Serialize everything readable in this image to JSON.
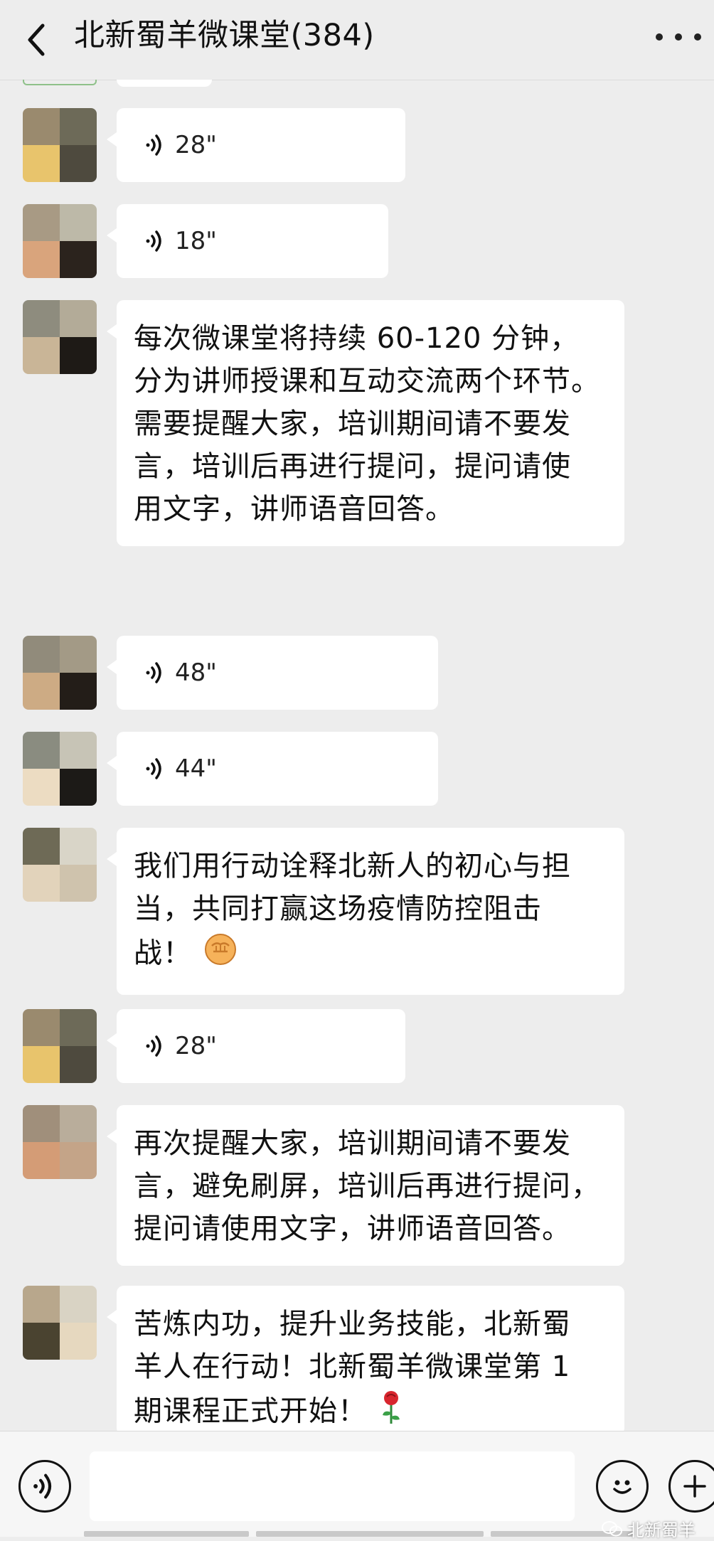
{
  "header": {
    "title": "北新蜀羊微课堂(384)",
    "back_icon": "chevron-left-icon",
    "more_icon": "more-horizontal-icon"
  },
  "messages": [
    {
      "type": "voice",
      "duration": "28\""
    },
    {
      "type": "voice",
      "duration": "18\""
    },
    {
      "type": "text",
      "lines": [
        "每次微课堂将持续 60-120 分钟，",
        "分为讲师授课和互动交流两个环节。",
        "需要提醒大家，培训期间请不要发",
        "言，培训后再进行提问，提问请使",
        "用文字，讲师语音回答。"
      ]
    },
    {
      "type": "voice",
      "duration": "48\""
    },
    {
      "type": "voice",
      "duration": "44\""
    },
    {
      "type": "text",
      "lines": [
        "我们用行动诠释北新人的初心与担",
        "当，共同打赢这场疫情防控阻击",
        "战！"
      ],
      "emoji": "raised-fist-icon"
    },
    {
      "type": "voice",
      "duration": "28\""
    },
    {
      "type": "text",
      "lines": [
        "再次提醒大家，培训期间请不要发",
        "言，避免刷屏，培训后再进行提问，",
        "提问请使用文字，讲师语音回答。"
      ]
    },
    {
      "type": "text",
      "lines": [
        "苦炼内功，提升业务技能，北新蜀",
        "羊人在行动！北新蜀羊微课堂第 1",
        "期课程正式开始！"
      ],
      "emoji": "rose-icon"
    }
  ],
  "input_bar": {
    "voice_icon": "voice-input-icon",
    "emoji_icon": "emoji-face-icon",
    "plus_icon": "plus-icon"
  },
  "watermark": {
    "text": "北新蜀羊",
    "icon": "wechat-logo-icon"
  }
}
